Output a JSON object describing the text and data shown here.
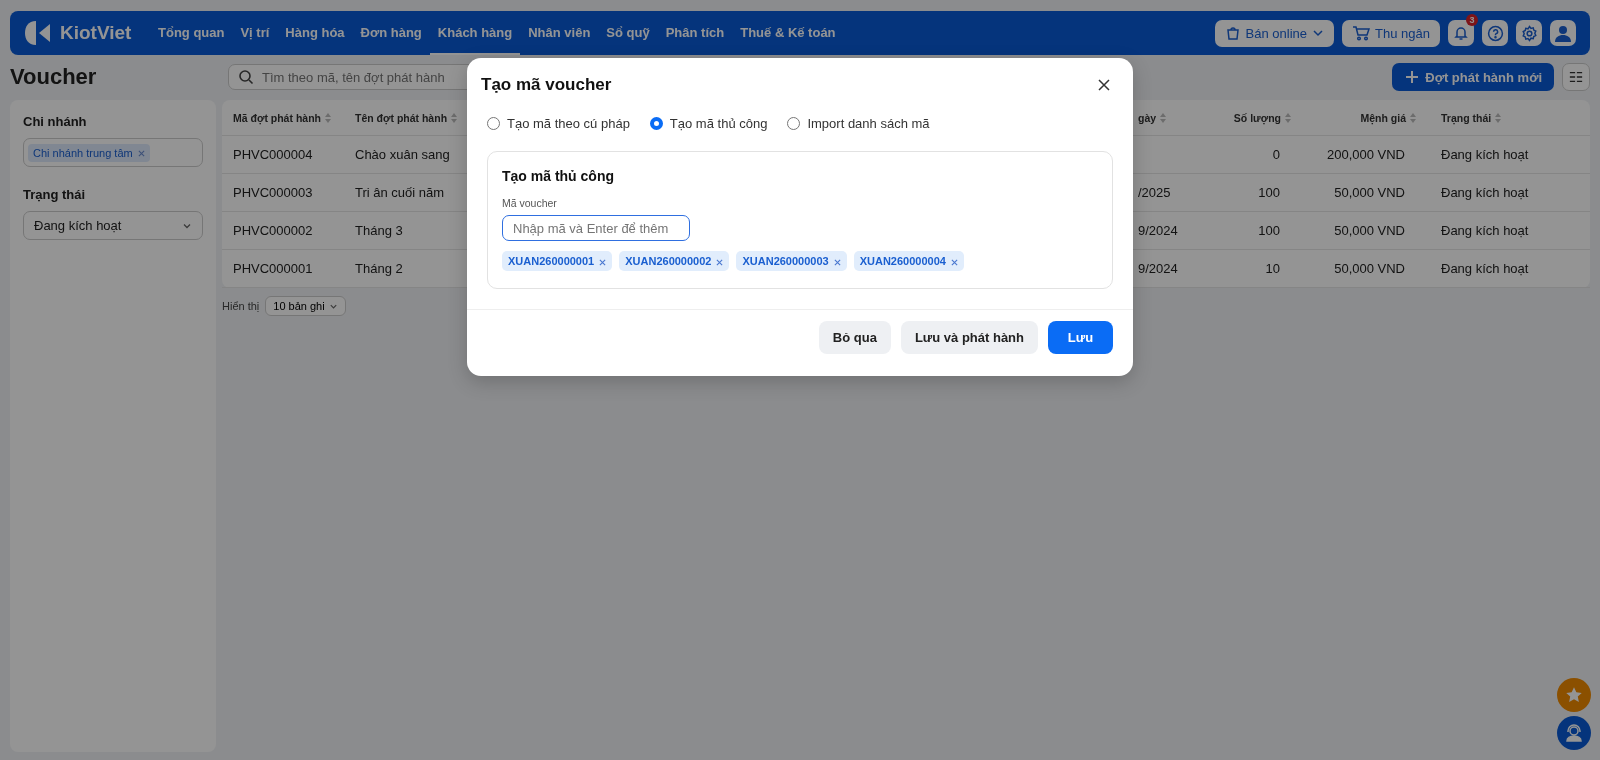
{
  "app": {
    "logo": "KiotViet"
  },
  "nav": [
    {
      "label": "Tổng quan",
      "selected": false
    },
    {
      "label": "Vị trí",
      "selected": false
    },
    {
      "label": "Hàng hóa",
      "selected": false
    },
    {
      "label": "Đơn hàng",
      "selected": false
    },
    {
      "label": "Khách hàng",
      "selected": true
    },
    {
      "label": "Nhân viên",
      "selected": false
    },
    {
      "label": "Sổ quỹ",
      "selected": false
    },
    {
      "label": "Phân tích",
      "selected": false
    },
    {
      "label": "Thuế & Kế toán",
      "selected": false
    }
  ],
  "top_actions": {
    "online": "Bán online",
    "cashier": "Thu ngân",
    "notification_count": "3"
  },
  "page": {
    "title": "Voucher",
    "search_placeholder": "Tìm theo mã, tên đợt phát hành",
    "new_button": "Đợt phát hành mới"
  },
  "filters": {
    "branch_label": "Chi nhánh",
    "branch_tags": [
      "Chi nhánh trung tâm"
    ],
    "status_label": "Trạng thái",
    "status_value": "Đang kích hoạt"
  },
  "table": {
    "columns": [
      "Mã đợt phát hành",
      "Tên đợt phát hành",
      "gày",
      "Số lượng",
      "Mệnh giá",
      "Trạng thái"
    ],
    "rows": [
      {
        "code": "PHVC000004",
        "name": "Chào xuân sang",
        "quantity": "0",
        "value": "200,000 VND",
        "status": "Đang kích hoạt"
      },
      {
        "code": "PHVC000003",
        "name": "Tri ân cuối năm",
        "column_3": "/2025",
        "quantity": "100",
        "value": "50,000 VND",
        "status": "Đang kích hoạt"
      },
      {
        "code": "PHVC000002",
        "name": "Tháng 3",
        "column_3": "9/2024",
        "quantity": "100",
        "value": "50,000 VND",
        "status": "Đang kích hoạt"
      },
      {
        "code": "PHVC000001",
        "name": "Tháng 2",
        "column_3": "9/2024",
        "quantity": "10",
        "value": "50,000 VND",
        "status": "Đang kích hoạt"
      }
    ]
  },
  "pagination": {
    "label": "Hiển thị",
    "page_size": "10 bản ghi"
  },
  "dialog": {
    "title": "Tạo mã voucher",
    "modes": [
      {
        "label": "Tạo mã theo cú pháp",
        "selected": false
      },
      {
        "label": "Tạo mã thủ công",
        "selected": true
      },
      {
        "label": "Import danh sách mã",
        "selected": false
      }
    ],
    "section_title": "Tạo mã thủ công",
    "field_label": "Mã voucher",
    "placeholder": "Nhập mã và Enter để thêm",
    "codes": [
      "XUAN260000001",
      "XUAN260000002",
      "XUAN260000003",
      "XUAN260000004"
    ],
    "buttons": [
      "Bỏ qua",
      "Lưu và phát hành",
      "Lưu"
    ]
  }
}
